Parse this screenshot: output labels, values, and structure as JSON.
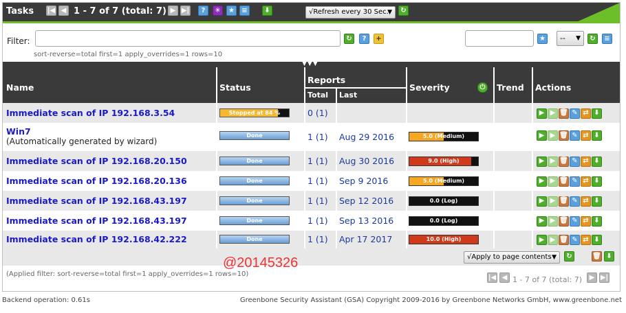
{
  "header": {
    "title": "Tasks",
    "pagination": "1 - 7 of 7 (total: 7)",
    "refresh_select": "√Refresh every 30 Sec."
  },
  "filter": {
    "label": "Filter:",
    "value": "",
    "current": "sort-reverse=total first=1 apply_overrides=1 rows=10",
    "saved_select": "--"
  },
  "columns": {
    "name": "Name",
    "status": "Status",
    "reports": "Reports",
    "total": "Total",
    "last": "Last",
    "severity": "Severity",
    "trend": "Trend",
    "actions": "Actions"
  },
  "rows": [
    {
      "name": "Immediate scan of IP 192.168.3.54",
      "sub": "",
      "status": "Stopped at 84 %",
      "status_type": "progress",
      "progress": 84,
      "reports": "0 (1)",
      "last": "",
      "severity": "",
      "severity_value": null,
      "severity_color": ""
    },
    {
      "name": "Win7",
      "sub": "(Automatically generated by wizard)",
      "status": "Done",
      "status_type": "done",
      "reports": "1 (1)",
      "last": "Aug 29 2016",
      "severity": "5.0 (Medium)",
      "severity_value": 5.0,
      "severity_color": "#f5a623"
    },
    {
      "name": "Immediate scan of IP 192.168.20.150",
      "sub": "",
      "status": "Done",
      "status_type": "done",
      "reports": "1 (1)",
      "last": "Aug 30 2016",
      "severity": "9.0 (High)",
      "severity_value": 9.0,
      "severity_color": "#d03a1a"
    },
    {
      "name": "Immediate scan of IP 192.168.20.136",
      "sub": "",
      "status": "Done",
      "status_type": "done",
      "reports": "1 (1)",
      "last": "Sep 9 2016",
      "severity": "5.0 (Medium)",
      "severity_value": 5.0,
      "severity_color": "#f5a623"
    },
    {
      "name": "Immediate scan of IP 192.168.43.197",
      "sub": "",
      "status": "Done",
      "status_type": "done",
      "reports": "1 (1)",
      "last": "Sep 12 2016",
      "severity": "0.0 (Log)",
      "severity_value": 0.0,
      "severity_color": "#111111"
    },
    {
      "name": "Immediate scan of IP 192.168.43.197",
      "sub": "",
      "status": "Done",
      "status_type": "done",
      "reports": "1 (1)",
      "last": "Sep 13 2016",
      "severity": "0.0 (Log)",
      "severity_value": 0.0,
      "severity_color": "#111111"
    },
    {
      "name": "Immediate scan of IP 192.168.42.222",
      "sub": "",
      "status": "Done",
      "status_type": "done",
      "reports": "1 (1)",
      "last": "Apr 17 2017",
      "severity": "10.0 (High)",
      "severity_value": 10.0,
      "severity_color": "#d03a1a"
    }
  ],
  "bulk": {
    "select": "√Apply to page contents"
  },
  "applied_filter": "(Applied filter: sort-reverse=total first=1 apply_overrides=1 rows=10)",
  "bottom_pagination": "1 - 7 of 7  (total:  7)",
  "watermark": "@20145326",
  "footer": {
    "backend": "Backend operation: 0.61s",
    "copyright": "Greenbone Security Assistant (GSA) Copyright 2009-2016 by Greenbone Networks GmbH, www.greenbone.net"
  },
  "icons": {
    "first": "first-page-icon",
    "prev": "previous-page-icon",
    "next": "next-page-icon",
    "last": "last-page-icon",
    "help": "help-icon",
    "wizard": "wizard-icon",
    "new": "new-task-icon",
    "list": "list-icon",
    "export": "export-icon",
    "refresh": "refresh-icon",
    "star": "star-icon",
    "edit": "edit-icon"
  }
}
